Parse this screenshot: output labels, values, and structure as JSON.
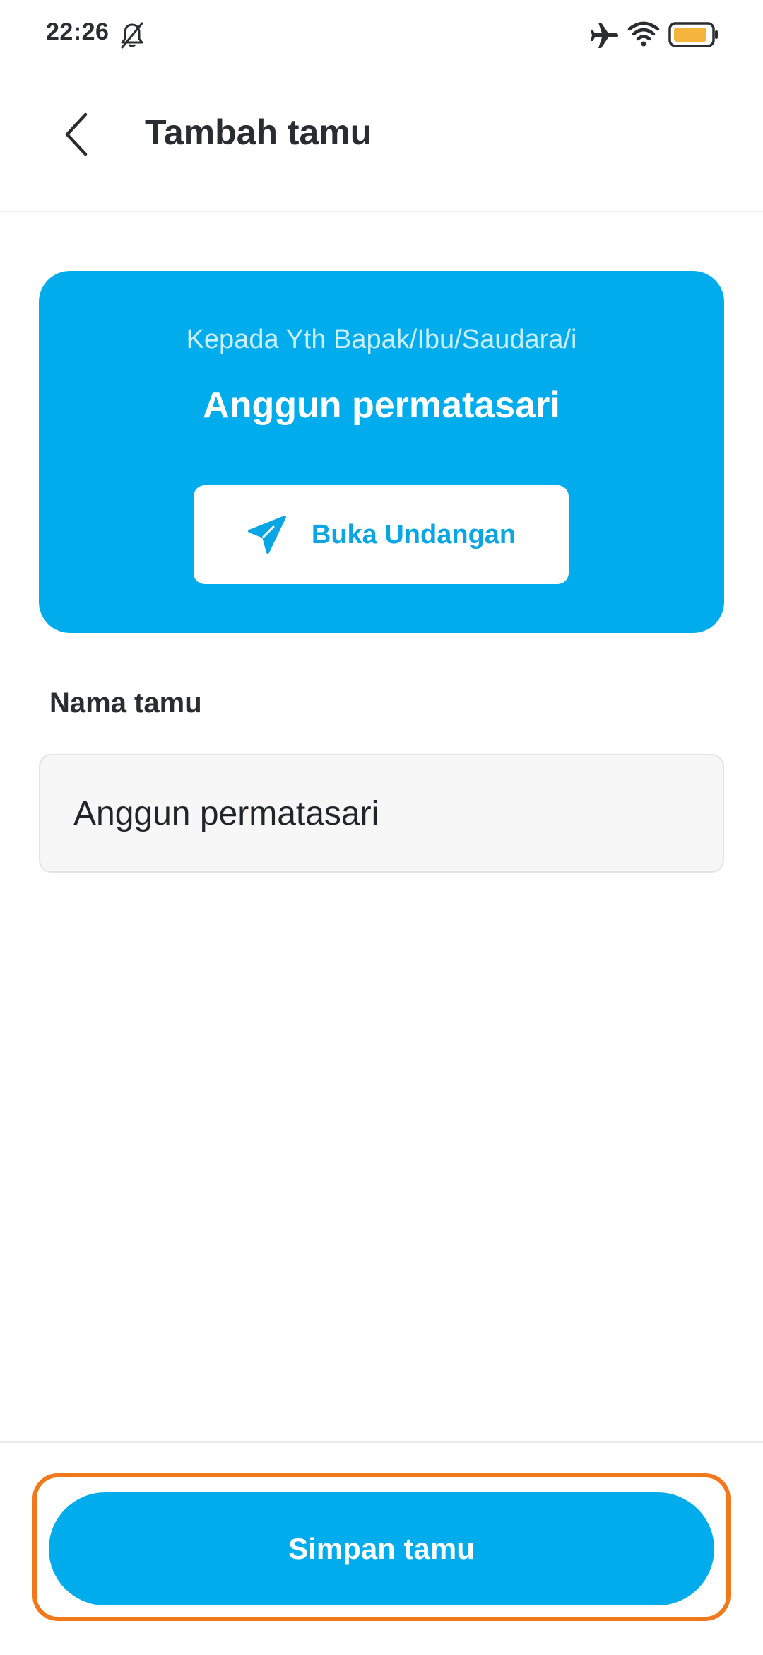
{
  "status_bar": {
    "time": "22:26",
    "icons": [
      "bell-off-icon",
      "airplane-icon",
      "wifi-icon",
      "battery-icon"
    ],
    "battery_color": "#f5b43c"
  },
  "header": {
    "back_icon": "chevron-left-icon",
    "title": "Tambah tamu"
  },
  "invitation_card": {
    "greeting": "Kepada Yth Bapak/Ibu/Saudara/i",
    "guest_name": "Anggun permatasari",
    "open_button": {
      "icon": "send-icon",
      "label": "Buka Undangan"
    }
  },
  "form": {
    "name_label": "Nama tamu",
    "name_value": "Anggun permatasari"
  },
  "footer": {
    "save_label": "Simpan tamu"
  },
  "colors": {
    "accent": "#00acec",
    "highlight": "#f2781c"
  }
}
